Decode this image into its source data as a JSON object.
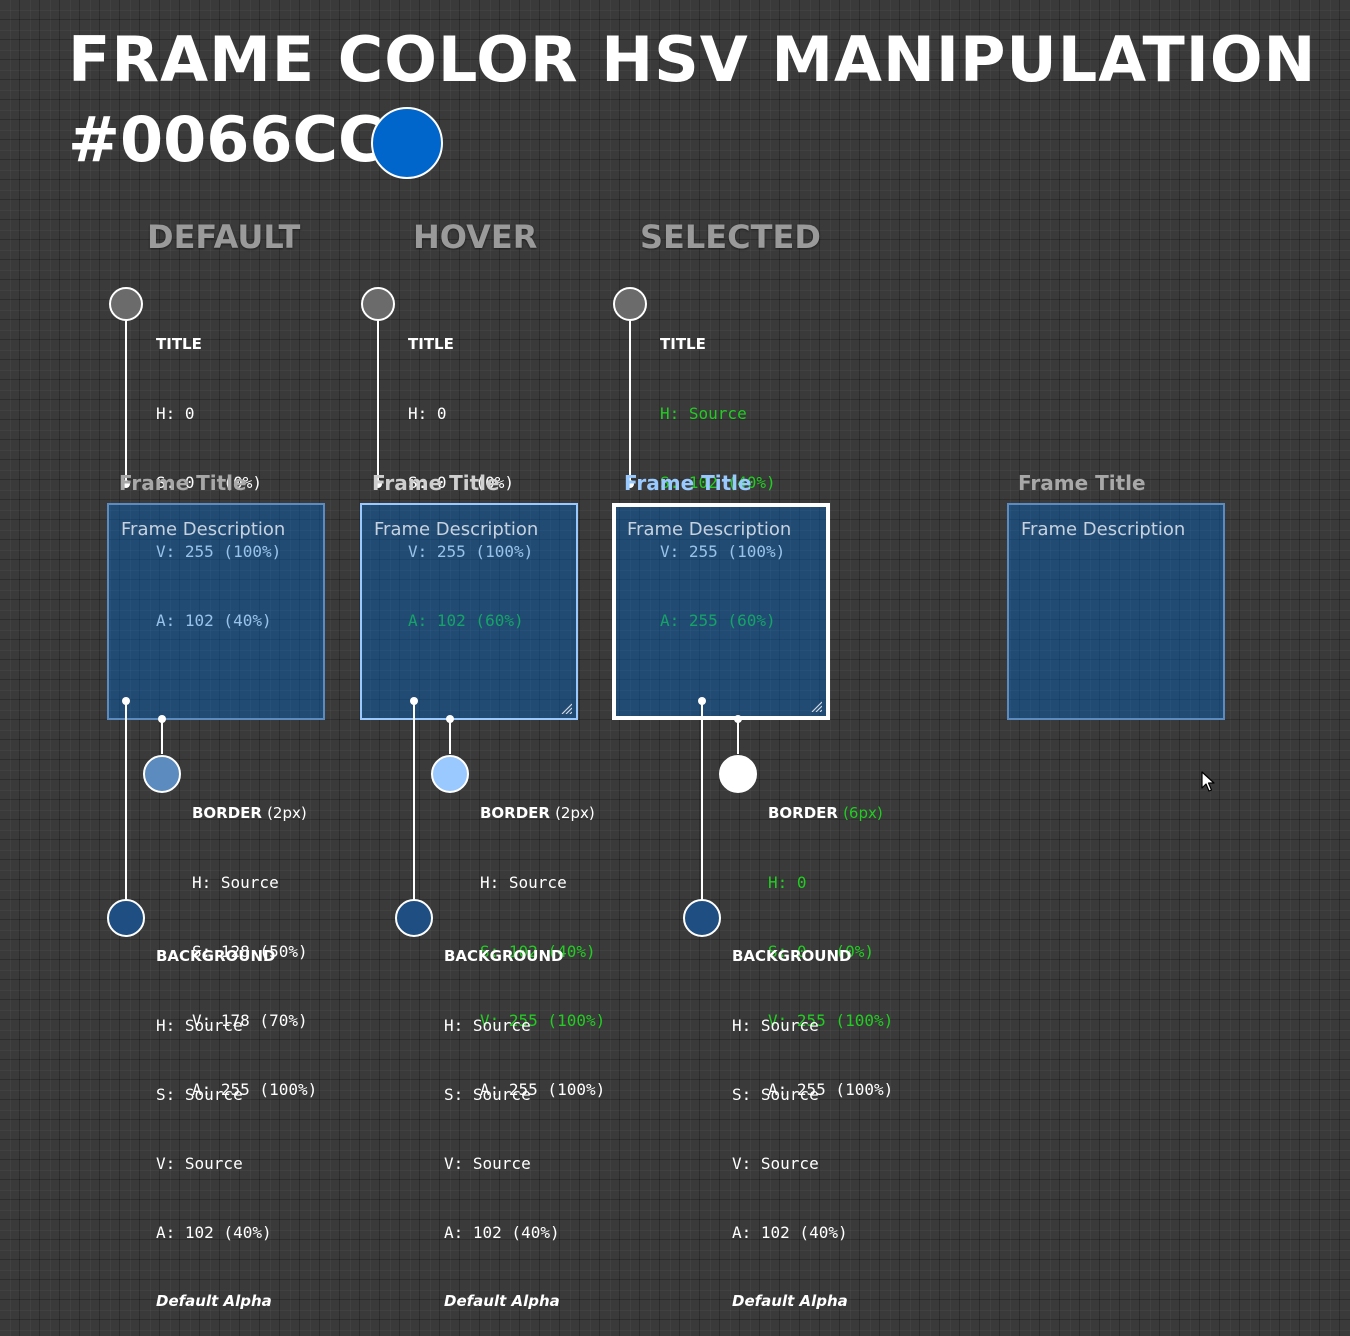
{
  "header": {
    "title": "FRAME COLOR HSV MANIPULATION",
    "hex": "#0066CC",
    "swatch_color": "#0066CC"
  },
  "states": [
    {
      "heading": "DEFAULT",
      "title_spec": {
        "label": "TITLE",
        "h": "H: 0",
        "s": "S: 0   (0%)",
        "v": "V: 255 (100%)",
        "a": "A: 102 (40%)"
      },
      "border_spec": {
        "label": "BORDER",
        "px": "(2px)",
        "h": "H: Source",
        "s": "S: 128 (50%)",
        "v": "V: 178 (70%)",
        "a": "A: 255 (100%)"
      },
      "background_spec": {
        "label": "BACKGROUND",
        "h": "H: Source",
        "s": "S: Source",
        "v": "V: Source",
        "a": "A: 102 (40%)",
        "note": "Default Alpha"
      },
      "frame_title": "Frame Title",
      "frame_description": "Frame Description",
      "title_color": "#a8a8a8",
      "border_color": "#5b8bbf",
      "title_dot_color": "#6b6b6b",
      "border_dot_color": "#5b8bbf",
      "bg_dot_color": "#1f4f82"
    },
    {
      "heading": "HOVER",
      "title_spec": {
        "label": "TITLE",
        "h": "H: 0",
        "s": "S: 0   (0%)",
        "v": "V: 255 (100%)",
        "a": "A: 102 (60%)"
      },
      "border_spec": {
        "label": "BORDER",
        "px": "(2px)",
        "h": "H: Source",
        "s": "S: 102 (40%)",
        "v": "V: 255 (100%)",
        "a": "A: 255 (100%)"
      },
      "background_spec": {
        "label": "BACKGROUND",
        "h": "H: Source",
        "s": "S: Source",
        "v": "V: Source",
        "a": "A: 102 (40%)",
        "note": "Default Alpha"
      },
      "frame_title": "Frame Title",
      "frame_description": "Frame Description",
      "title_color": "#cfcfcf",
      "border_color": "#99c9ff",
      "title_dot_color": "#6b6b6b",
      "border_dot_color": "#99c9ff",
      "bg_dot_color": "#1f4f82"
    },
    {
      "heading": "SELECTED",
      "title_spec": {
        "label": "TITLE",
        "h": "H: Source",
        "s": "S: 102 (40%)",
        "v": "V: 255 (100%)",
        "a": "A: 255 (60%)"
      },
      "border_spec": {
        "label": "BORDER",
        "px": "(6px)",
        "h": "H: 0",
        "s": "S: 0   (0%)",
        "v": "V: 255 (100%)",
        "a": "A: 255 (100%)"
      },
      "background_spec": {
        "label": "BACKGROUND",
        "h": "H: Source",
        "s": "S: Source",
        "v": "V: Source",
        "a": "A: 102 (40%)",
        "note": "Default Alpha"
      },
      "frame_title": "Frame Title",
      "frame_description": "Frame Description",
      "title_color": "#99c9ff",
      "border_color": "#ffffff",
      "title_dot_color": "#6b6b6b",
      "border_dot_color": "#ffffff",
      "bg_dot_color": "#1f4f82"
    }
  ],
  "extra_frame": {
    "frame_title": "Frame Title",
    "frame_description": "Frame Description",
    "title_color": "#a8a8a8",
    "border_color": "#5b8bbf"
  }
}
